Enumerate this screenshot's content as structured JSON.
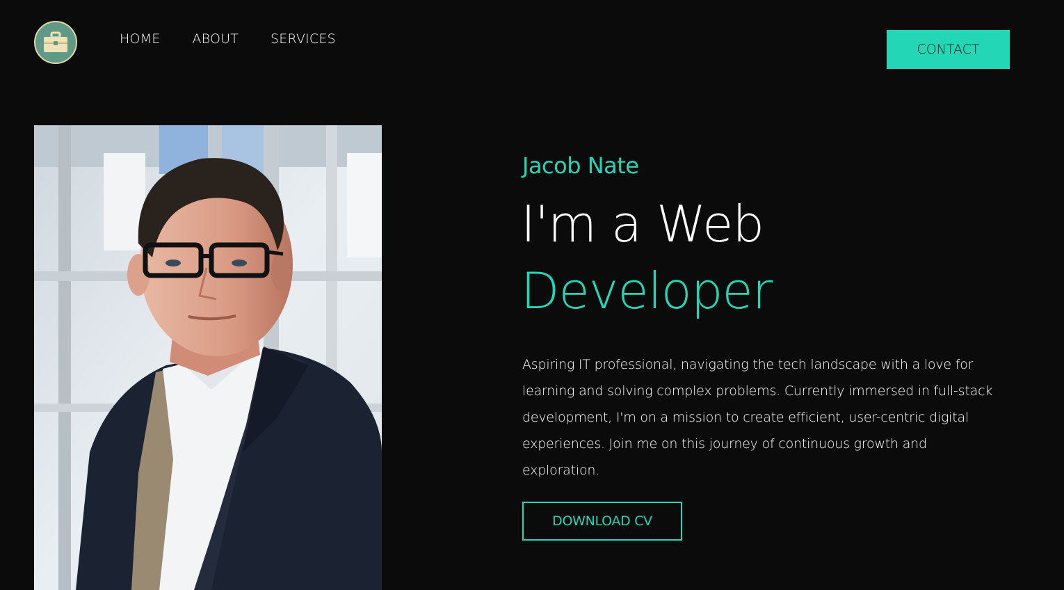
{
  "header": {
    "logo_icon": "briefcase-icon",
    "nav": [
      {
        "label": "HOME"
      },
      {
        "label": "ABOUT"
      },
      {
        "label": "SERVICES"
      }
    ],
    "contact_label": "CONTACT"
  },
  "hero": {
    "name": "Jacob Nate",
    "headline_line1": "I'm a Web",
    "headline_line2": "Developer",
    "description": "Aspiring IT professional, navigating the tech landscape with a love for learning and solving complex problems. Currently immersed in full-stack development, I'm on a mission to create efficient, user-centric digital experiences. Join me on this journey of continuous growth and exploration.",
    "download_label": "DOWNLOAD CV",
    "photo": "portrait-photo"
  },
  "colors": {
    "background": "#0b0b0c",
    "accent": "#22d6b6",
    "text": "#ffffff",
    "logo_bg": "#5e9a86",
    "logo_ring": "#e6d6a6"
  }
}
